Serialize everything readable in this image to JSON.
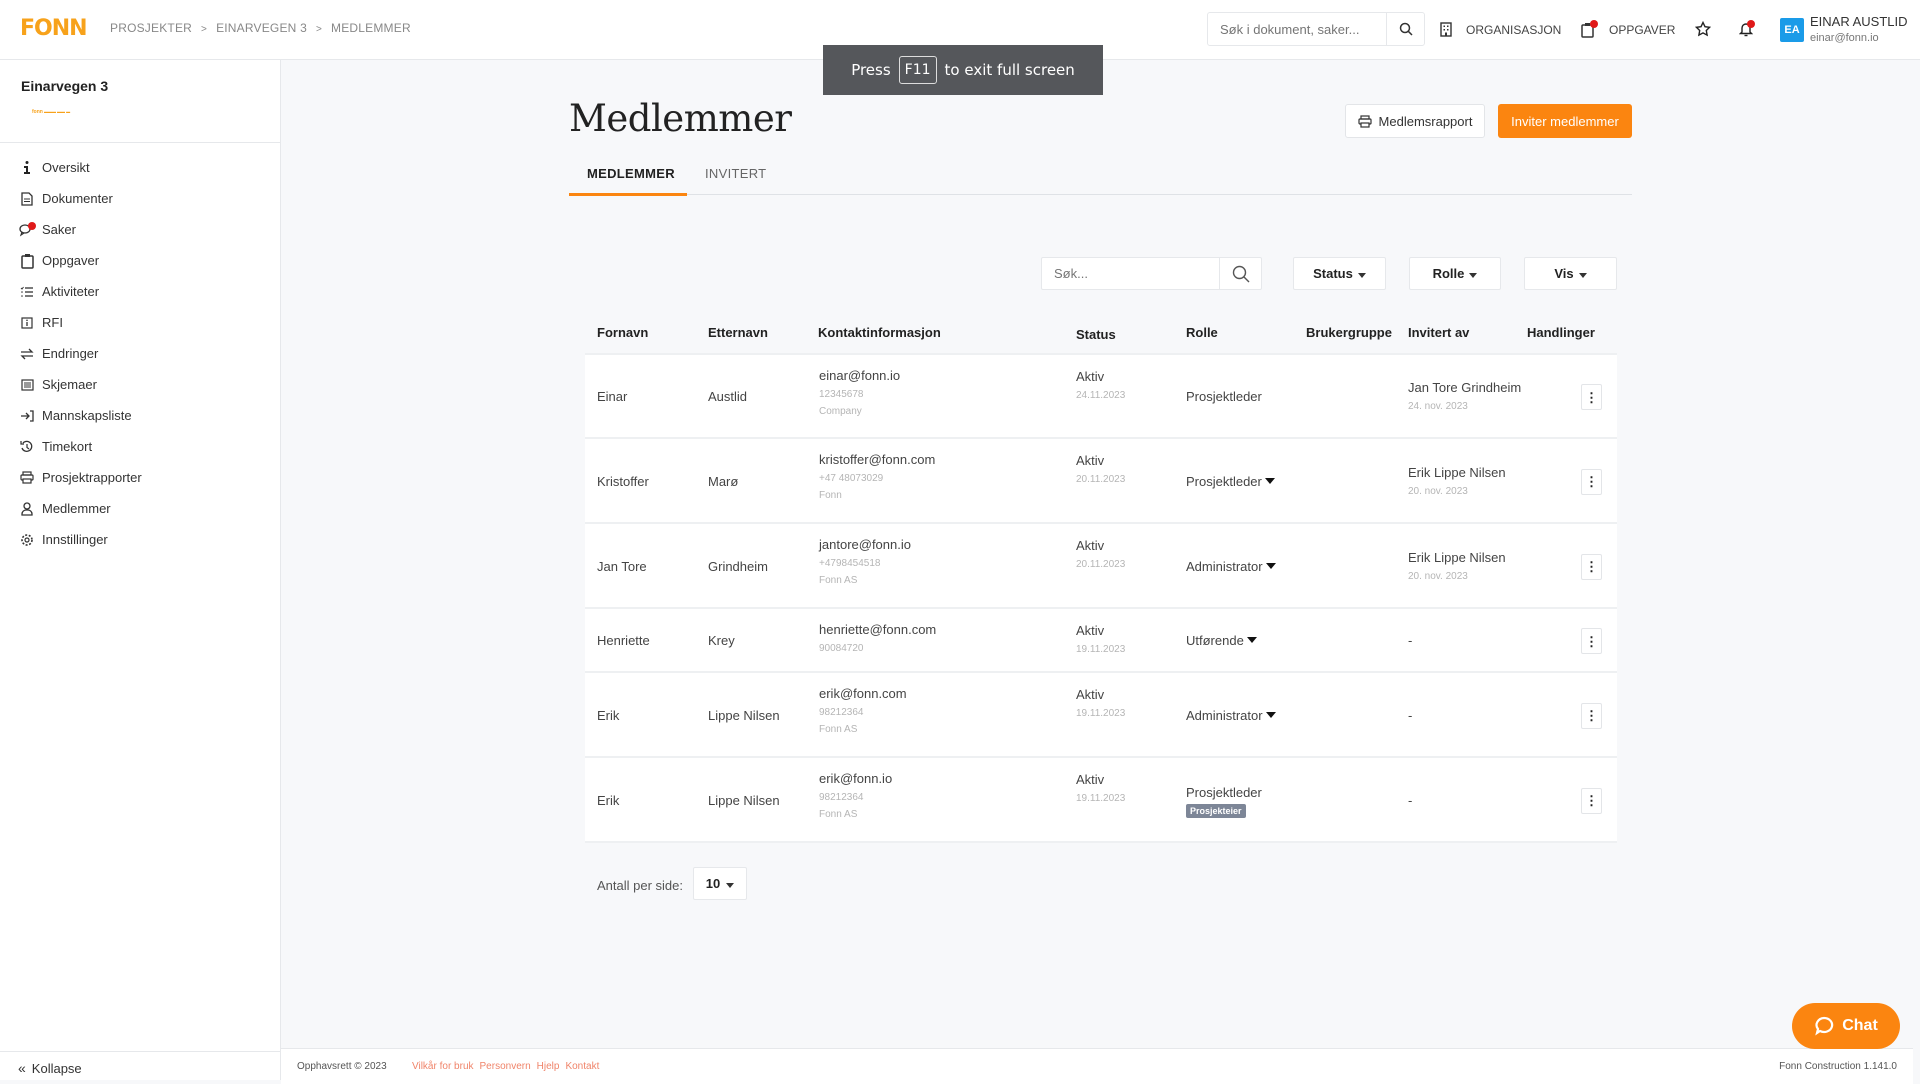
{
  "header": {
    "logo": "FONN",
    "breadcrumbs": [
      "PROSJEKTER",
      "EINARVEGEN 3",
      "MEDLEMMER"
    ],
    "search_placeholder": "Søk i dokument, saker...",
    "organisation_label": "ORGANISASJON",
    "tasks_label": "OPPGAVER",
    "user": {
      "initials": "EA",
      "name": "EINAR AUSTLID",
      "email": "einar@fonn.io"
    }
  },
  "fullscreen_toast": {
    "press": "Press",
    "key": "F11",
    "rest": "to exit full screen"
  },
  "sidebar": {
    "project_title": "Einarvegen 3",
    "project_logo_text": "fonn",
    "items": [
      {
        "label": "Oversikt",
        "icon": "info-icon"
      },
      {
        "label": "Dokumenter",
        "icon": "document-icon"
      },
      {
        "label": "Saker",
        "icon": "chat-bubbles-icon"
      },
      {
        "label": "Oppgaver",
        "icon": "clipboard-icon"
      },
      {
        "label": "Aktiviteter",
        "icon": "checklist-icon"
      },
      {
        "label": "RFI",
        "icon": "rfi-icon"
      },
      {
        "label": "Endringer",
        "icon": "swap-icon"
      },
      {
        "label": "Skjemaer",
        "icon": "form-icon"
      },
      {
        "label": "Mannskapsliste",
        "icon": "sign-in-icon"
      },
      {
        "label": "Timekort",
        "icon": "history-icon"
      },
      {
        "label": "Prosjektrapporter",
        "icon": "printer-icon"
      },
      {
        "label": "Medlemmer",
        "icon": "user-icon"
      },
      {
        "label": "Innstillinger",
        "icon": "gear-icon"
      }
    ],
    "collapse_label": "Kollapse"
  },
  "page": {
    "title": "Medlemmer",
    "report_button": "Medlemsrapport",
    "invite_button": "Inviter medlemmer",
    "tabs": [
      {
        "label": "MEDLEMMER",
        "active": true
      },
      {
        "label": "INVITERT",
        "active": false
      }
    ],
    "filters": {
      "search_placeholder": "Søk...",
      "status": "Status",
      "role": "Rolle",
      "view": "Vis"
    }
  },
  "table": {
    "columns": [
      "Fornavn",
      "Etternavn",
      "Kontaktinformasjon",
      "Status",
      "Rolle",
      "Brukergruppe",
      "Invitert av",
      "Handlinger"
    ],
    "rows": [
      {
        "first": "Einar",
        "last": "Austlid",
        "email": "einar@fonn.io",
        "phone": "12345678",
        "company": "Company",
        "status": "Aktiv",
        "status_date": "24.11.2023",
        "role": "Prosjektleder",
        "role_dropdown": false,
        "badge": "",
        "group": "",
        "invited_by": "Jan Tore Grindheim",
        "invited_date": "24. nov. 2023"
      },
      {
        "first": "Kristoffer",
        "last": "Marø",
        "email": "kristoffer@fonn.com",
        "phone": "+47 48073029",
        "company": "Fonn",
        "status": "Aktiv",
        "status_date": "20.11.2023",
        "role": "Prosjektleder",
        "role_dropdown": true,
        "badge": "",
        "group": "",
        "invited_by": "Erik Lippe Nilsen",
        "invited_date": "20. nov. 2023"
      },
      {
        "first": "Jan Tore",
        "last": "Grindheim",
        "email": "jantore@fonn.io",
        "phone": "+4798454518",
        "company": "Fonn AS",
        "status": "Aktiv",
        "status_date": "20.11.2023",
        "role": "Administrator",
        "role_dropdown": true,
        "badge": "",
        "group": "",
        "invited_by": "Erik Lippe Nilsen",
        "invited_date": "20. nov. 2023"
      },
      {
        "first": "Henriette",
        "last": "Krey",
        "email": "henriette@fonn.com",
        "phone": "90084720",
        "company": "",
        "status": "Aktiv",
        "status_date": "19.11.2023",
        "role": "Utførende",
        "role_dropdown": true,
        "badge": "",
        "group": "",
        "invited_by": "-",
        "invited_date": ""
      },
      {
        "first": "Erik",
        "last": "Lippe Nilsen",
        "email": "erik@fonn.com",
        "phone": "98212364",
        "company": "Fonn AS",
        "status": "Aktiv",
        "status_date": "19.11.2023",
        "role": "Administrator",
        "role_dropdown": true,
        "badge": "",
        "group": "",
        "invited_by": "-",
        "invited_date": ""
      },
      {
        "first": "Erik",
        "last": "Lippe Nilsen",
        "email": "erik@fonn.io",
        "phone": "98212364",
        "company": "Fonn AS",
        "status": "Aktiv",
        "status_date": "19.11.2023",
        "role": "Prosjektleder",
        "role_dropdown": false,
        "badge": "Prosjekteier",
        "group": "",
        "invited_by": "-",
        "invited_date": ""
      }
    ]
  },
  "pagination": {
    "label": "Antall per side:",
    "value": "10"
  },
  "footer": {
    "copyright": "Opphavsrett © 2023",
    "links": [
      "Vilkår for bruk",
      "Personvern",
      "Hjelp",
      "Kontakt"
    ],
    "version": "Fonn Construction 1.141.0"
  },
  "chat_button": "Chat",
  "colors": {
    "accent": "#fb8510",
    "avatar": "#1a9be8",
    "notification": "#e01919",
    "badge": "#7d8697"
  }
}
